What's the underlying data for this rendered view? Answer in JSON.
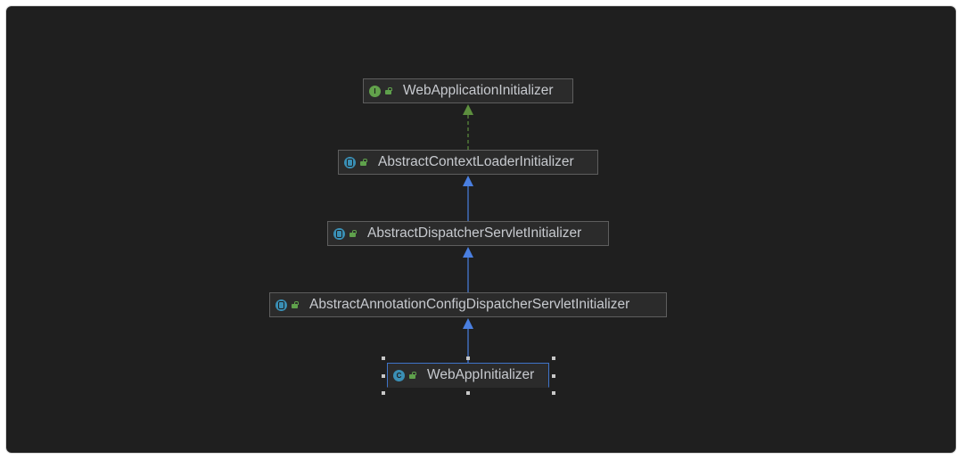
{
  "diagram": {
    "nodes": [
      {
        "id": "web-application-initializer",
        "name": "WebApplicationInitializer",
        "kind": "interface-icon",
        "kind_letter": "I"
      },
      {
        "id": "abstract-context-loader-initializer",
        "name": "AbstractContextLoaderInitializer",
        "kind": "abstract-class-icon",
        "kind_letter": ""
      },
      {
        "id": "abstract-dispatcher-servlet-initializer",
        "name": "AbstractDispatcherServletInitializer",
        "kind": "abstract-class-icon",
        "kind_letter": ""
      },
      {
        "id": "abstract-annotation-config-dispatcher-servlet-initializer",
        "name": "AbstractAnnotationConfigDispatcherServletInitializer",
        "kind": "abstract-class-icon",
        "kind_letter": ""
      },
      {
        "id": "web-app-initializer",
        "name": "WebAppInitializer",
        "kind": "class-icon",
        "kind_letter": "C",
        "selected": true
      }
    ],
    "edges": [
      {
        "from": "abstract-context-loader-initializer",
        "to": "web-application-initializer",
        "type": "implements",
        "color": "#5d8f3e",
        "dashed": true
      },
      {
        "from": "abstract-dispatcher-servlet-initializer",
        "to": "abstract-context-loader-initializer",
        "type": "extends",
        "color": "#4a7fe0",
        "dashed": false
      },
      {
        "from": "abstract-annotation-config-dispatcher-servlet-initializer",
        "to": "abstract-dispatcher-servlet-initializer",
        "type": "extends",
        "color": "#4a7fe0",
        "dashed": false
      },
      {
        "from": "web-app-initializer",
        "to": "abstract-annotation-config-dispatcher-servlet-initializer",
        "type": "extends",
        "color": "#4a7fe0",
        "dashed": false
      }
    ],
    "colors": {
      "background": "#1f1f1f",
      "node_fill": "#2b2b2b",
      "node_border": "#5e5e5e",
      "text": "#c7cacf",
      "selection": "#3f74c9"
    }
  }
}
